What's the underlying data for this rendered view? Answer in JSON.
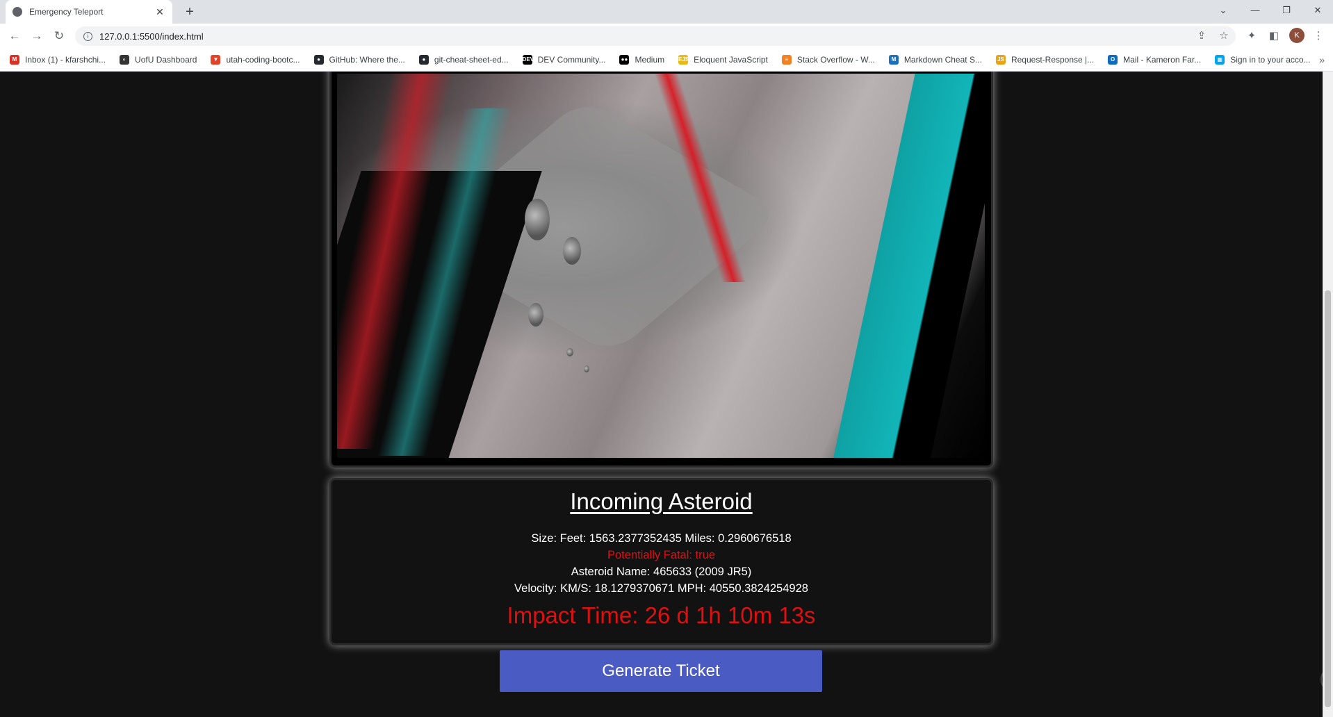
{
  "browser": {
    "tab_title": "Emergency Teleport",
    "tab_close": "✕",
    "new_tab": "+",
    "url": "127.0.0.1:5500/index.html",
    "avatar_letter": "K",
    "bookmarks": [
      {
        "label": "Inbox (1) - kfarshchi...",
        "icon": "gmail-icon",
        "color": "#d93025",
        "glyph": "M"
      },
      {
        "label": "UofU Dashboard",
        "icon": "canvas-icon",
        "color": "#333333",
        "glyph": "◐"
      },
      {
        "label": "utah-coding-bootc...",
        "icon": "gitlab-icon",
        "color": "#e24329",
        "glyph": "▼"
      },
      {
        "label": "GitHub: Where the...",
        "icon": "github-icon",
        "color": "#24292f",
        "glyph": "●"
      },
      {
        "label": "git-cheat-sheet-ed...",
        "icon": "github-icon",
        "color": "#24292f",
        "glyph": "●"
      },
      {
        "label": "DEV Community...",
        "icon": "dev-icon",
        "color": "#000000",
        "glyph": "DEV"
      },
      {
        "label": "Medium",
        "icon": "medium-icon",
        "color": "#000000",
        "glyph": "●●"
      },
      {
        "label": "Eloquent JavaScript",
        "icon": "ejs-icon",
        "color": "#e8b917",
        "glyph": "EJS"
      },
      {
        "label": "Stack Overflow - W...",
        "icon": "stackoverflow-icon",
        "color": "#f48024",
        "glyph": "≡"
      },
      {
        "label": "Markdown Cheat S...",
        "icon": "markdown-icon",
        "color": "#1f6fbf",
        "glyph": "M"
      },
      {
        "label": "Request-Response |...",
        "icon": "rr-icon",
        "color": "#e8a317",
        "glyph": "JS"
      },
      {
        "label": "Mail - Kameron Far...",
        "icon": "outlook-icon",
        "color": "#0f6cbd",
        "glyph": "O"
      },
      {
        "label": "Sign in to your acco...",
        "icon": "microsoft-icon",
        "color": "#00a4ef",
        "glyph": "▦"
      }
    ],
    "bookmarks_more": "»"
  },
  "page": {
    "title": "Incoming Asteroid",
    "size_line": "Size: Feet: 1563.2377352435 Miles: 0.2960676518",
    "fatal_line": "Potentially Fatal: true",
    "name_line": "Asteroid Name: 465633 (2009 JR5)",
    "velocity_line": "Velocity: KM/S: 18.1279370671 MPH: 40550.3824254928",
    "impact_line": "Impact Time: 26 d 1h 10m 13s",
    "button_label": "Generate Ticket"
  },
  "colors": {
    "danger": "#e01010",
    "button": "#4b5bc4",
    "background": "#121212"
  }
}
